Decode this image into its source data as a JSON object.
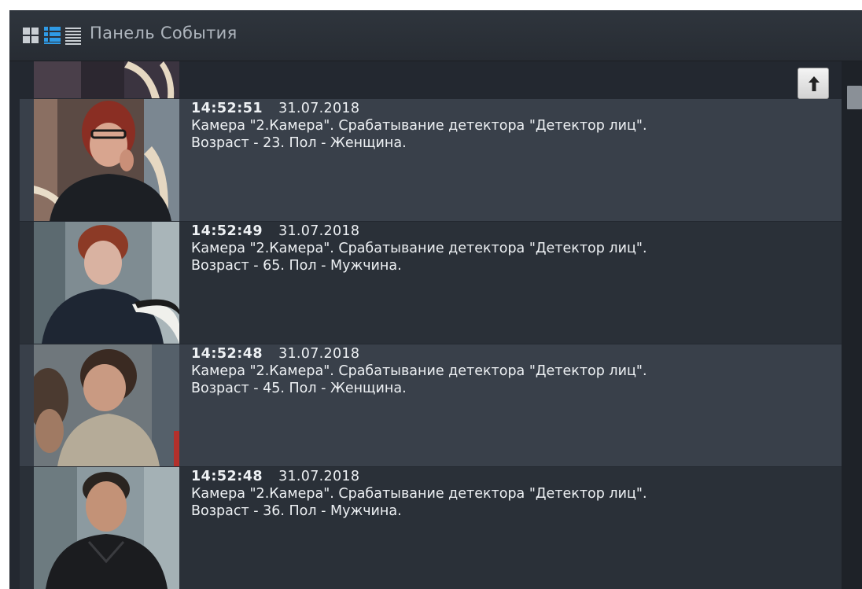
{
  "header": {
    "title": "Панель События",
    "view_modes": [
      "grid-view-icon",
      "list-view-icon",
      "compact-list-view-icon"
    ],
    "active_view": "list-view-icon"
  },
  "events": [
    {
      "time": "14:52:51",
      "date": "31.07.2018",
      "line1": "Камера \"2.Камера\". Срабатывание детектора \"Детектор лиц\".",
      "line2": "Возраст - 23. Пол - Женщина.",
      "thumbnail": "face-thumbnail"
    },
    {
      "time": "14:52:49",
      "date": "31.07.2018",
      "line1": "Камера \"2.Камера\". Срабатывание детектора \"Детектор лиц\".",
      "line2": "Возраст - 65. Пол - Мужчина.",
      "thumbnail": "face-thumbnail"
    },
    {
      "time": "14:52:48",
      "date": "31.07.2018",
      "line1": "Камера \"2.Камера\". Срабатывание детектора \"Детектор лиц\".",
      "line2": "Возраст - 45. Пол - Женщина.",
      "thumbnail": "face-thumbnail"
    },
    {
      "time": "14:52:48",
      "date": "31.07.2018",
      "line1": "Камера \"2.Камера\". Срабатывание детектора \"Детектор лиц\".",
      "line2": "Возраст - 36. Пол - Мужчина.",
      "thumbnail": "face-thumbnail"
    }
  ],
  "scroll_to_top_icon": "arrow-up-icon",
  "colors": {
    "accent": "#2f9be6",
    "row_light": "#39404a",
    "row_dark": "#2a3038"
  }
}
